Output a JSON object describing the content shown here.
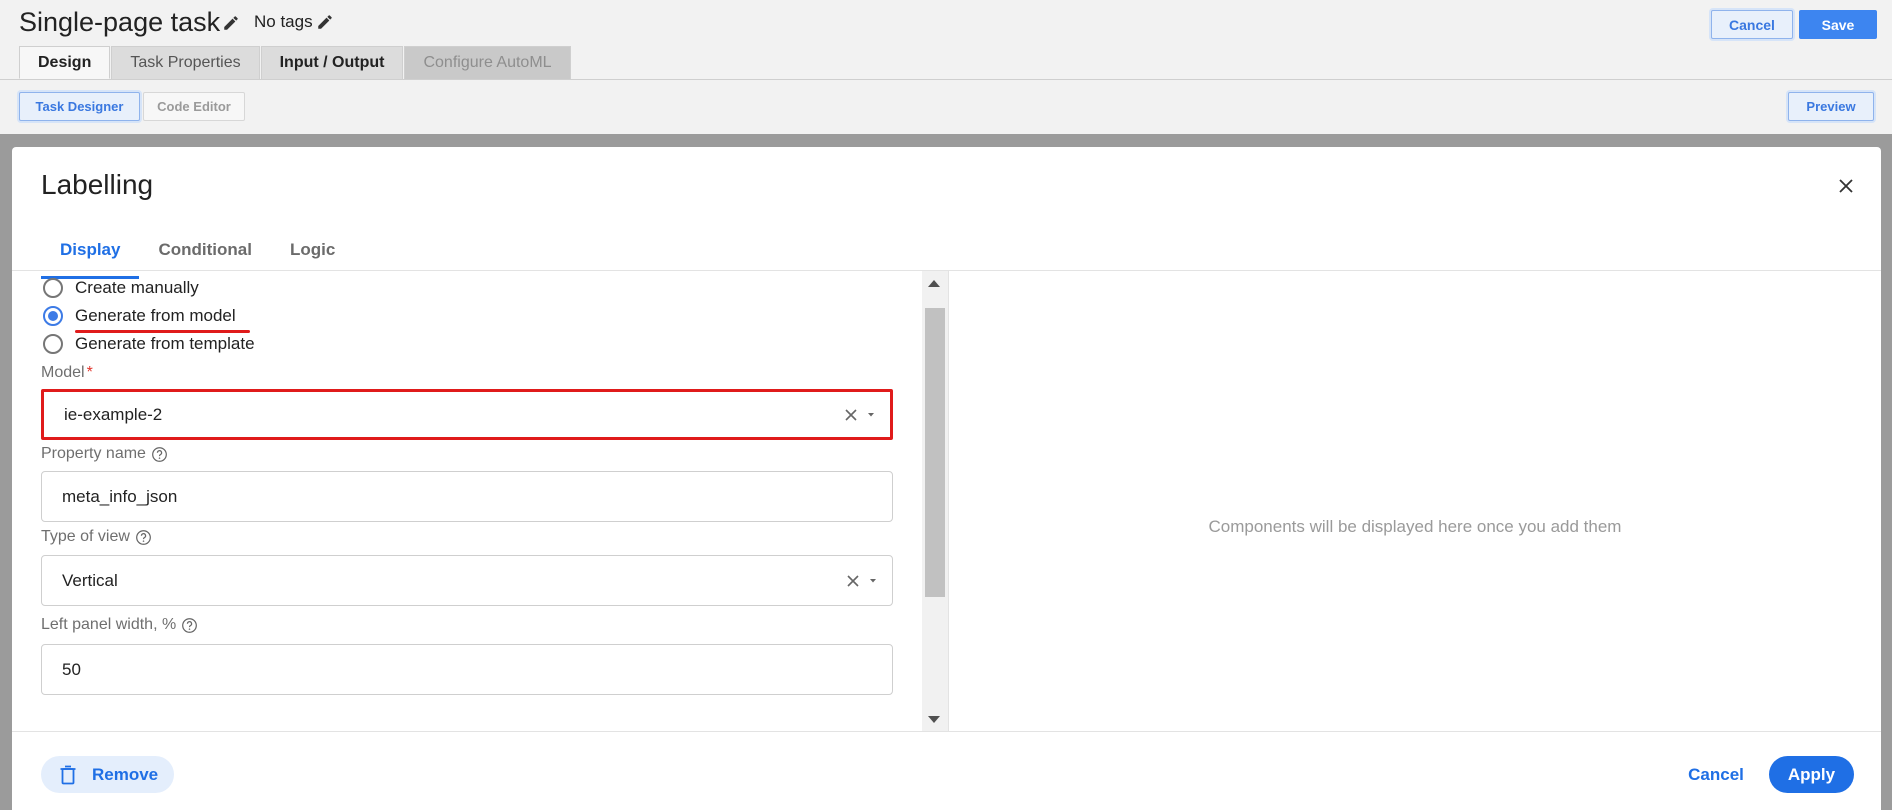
{
  "header": {
    "title": "Single-page task",
    "tags": "No tags",
    "cancel_label": "Cancel",
    "save_label": "Save"
  },
  "main_tabs": [
    {
      "label": "Design",
      "state": "active"
    },
    {
      "label": "Task Properties",
      "state": "normal"
    },
    {
      "label": "Input / Output",
      "state": "normal"
    },
    {
      "label": "Configure AutoML",
      "state": "disabled"
    }
  ],
  "subbar": {
    "task_designer": "Task Designer",
    "code_editor": "Code Editor",
    "preview": "Preview"
  },
  "modal": {
    "title": "Labelling",
    "tabs": [
      "Display",
      "Conditional",
      "Logic"
    ],
    "active_tab": "Display",
    "source_options": [
      {
        "label": "Create manually",
        "checked": false
      },
      {
        "label": "Generate from model",
        "checked": true
      },
      {
        "label": "Generate from template",
        "checked": false
      }
    ],
    "model": {
      "label": "Model",
      "required_mark": "*",
      "value": "ie-example-2"
    },
    "property_name": {
      "label": "Property name",
      "value": "meta_info_json"
    },
    "type_of_view": {
      "label": "Type of view",
      "value": "Vertical"
    },
    "left_panel_width": {
      "label": "Left panel width, %",
      "value": "50"
    },
    "preview_empty": "Components will be displayed here once you add them",
    "footer": {
      "remove_label": "Remove",
      "cancel_label": "Cancel",
      "apply_label": "Apply"
    }
  },
  "colors": {
    "accent": "#1f6fe5",
    "highlight_red": "#e01b1b",
    "overlay": "#9b9b9b"
  }
}
